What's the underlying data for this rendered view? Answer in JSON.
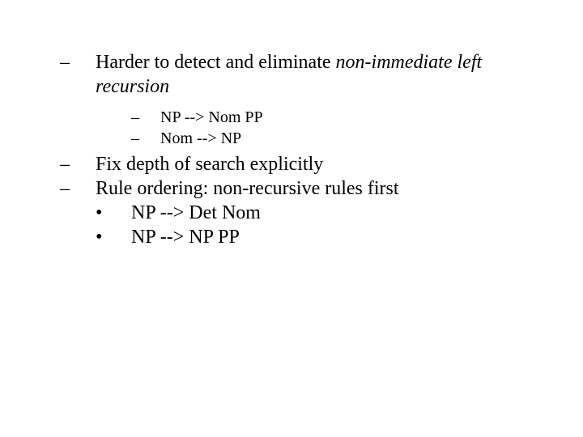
{
  "bullets": {
    "b1": {
      "marker": "–",
      "text_a": "Harder to detect and eliminate ",
      "text_b": "non-immediate left recursion"
    },
    "b1_sub1": {
      "marker": "–",
      "text": "NP --> Nom PP"
    },
    "b1_sub2": {
      "marker": "–",
      "text": "Nom --> NP"
    },
    "b2": {
      "marker": "–",
      "text": "Fix depth of search explicitly"
    },
    "b3": {
      "marker": "–",
      "text": "Rule ordering: non-recursive rules first"
    },
    "b3_sub1": {
      "marker": "•",
      "text": "NP --> Det Nom"
    },
    "b3_sub2": {
      "marker": "•",
      "text": "NP --> NP PP"
    }
  }
}
